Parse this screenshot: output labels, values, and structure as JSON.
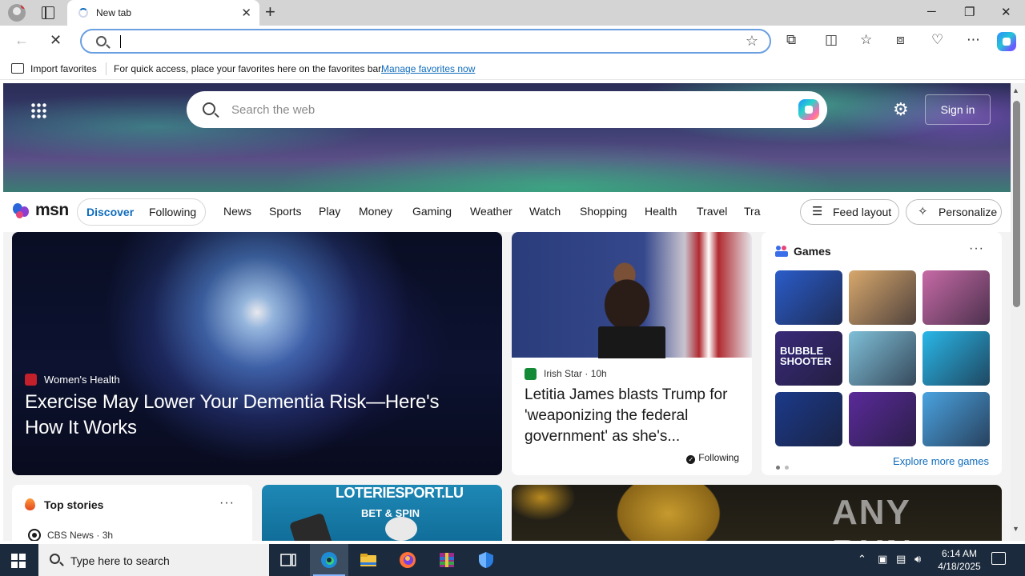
{
  "browser": {
    "tab_title": "New tab",
    "address_value": "",
    "window_controls": {
      "minimize": "─",
      "restore": "❐",
      "close": "✕"
    }
  },
  "favorites_bar": {
    "import_label": "Import favorites",
    "message": "For quick access, place your favorites here on the favorites bar.",
    "manage_link": "Manage favorites now"
  },
  "msn": {
    "search_placeholder": "Search the web",
    "sign_in_label": "Sign in",
    "logo_text": "msn",
    "feed_tabs": [
      {
        "label": "Discover",
        "active": true
      },
      {
        "label": "Following",
        "active": false
      }
    ],
    "nav_items": [
      "News",
      "Sports",
      "Play",
      "Money",
      "Gaming",
      "Weather",
      "Watch",
      "Shopping",
      "Health",
      "Travel",
      "Tra"
    ],
    "feed_layout_label": "Feed layout",
    "personalize_label": "Personalize"
  },
  "main_story": {
    "source": "Women's Health",
    "title": "Exercise May Lower Your Dementia Risk—Here's How It Works",
    "source_color": "#c4202c"
  },
  "second_story": {
    "source": "Irish Star",
    "age": "10h",
    "title": "Letitia James blasts Trump for 'weaponizing the federal government' as she's...",
    "following_label": "Following",
    "source_color": "#138a36"
  },
  "games": {
    "title": "Games",
    "tiles": [
      {
        "name": "Jewel puzzle",
        "color": "#2a5cc9",
        "label": ""
      },
      {
        "name": "Wood screw puzzle",
        "color": "#d8a86c",
        "label": ""
      },
      {
        "name": "Makeup brushes",
        "color": "#c76aa6",
        "label": ""
      },
      {
        "name": "Bubble Shooter HD",
        "color": "#3a2a7a",
        "label": "BUBBLE SHOOTER"
      },
      {
        "name": "Hospital game",
        "color": "#7fc0d8",
        "label": ""
      },
      {
        "name": "Mahjong",
        "color": "#29b7e8",
        "label": ""
      },
      {
        "name": "Block puzzle",
        "color": "#1b3a8a",
        "label": ""
      },
      {
        "name": "Paper plane",
        "color": "#5a2a9a",
        "label": ""
      },
      {
        "name": "Hotel game",
        "color": "#4aa3e0",
        "label": ""
      }
    ],
    "explore_label": "Explore more games"
  },
  "top_stories": {
    "title": "Top stories",
    "source": "CBS News",
    "age": "3h"
  },
  "ad": {
    "title": "LOTERIESPORT.LU",
    "subtitle": "BET & SPIN"
  },
  "watermark": "ANY RUN",
  "taskbar": {
    "search_placeholder": "Type here to search",
    "time": "6:14 AM",
    "date": "4/18/2025"
  }
}
